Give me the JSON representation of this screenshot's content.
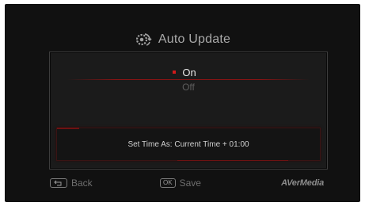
{
  "header": {
    "title": "Auto Update",
    "icon": "gear-sync-icon"
  },
  "options": [
    {
      "label": "On",
      "selected": true
    },
    {
      "label": "Off",
      "selected": false
    }
  ],
  "time_setting": {
    "text": "Set Time As: Current Time + 01:00"
  },
  "footer": {
    "back_key": "⮌",
    "back_label": "Back",
    "save_key": "OK",
    "save_label": "Save",
    "brand": "AVerMedia"
  },
  "colors": {
    "accent": "#d11b1b",
    "background": "#111111",
    "panel": "#1b1b1b"
  }
}
